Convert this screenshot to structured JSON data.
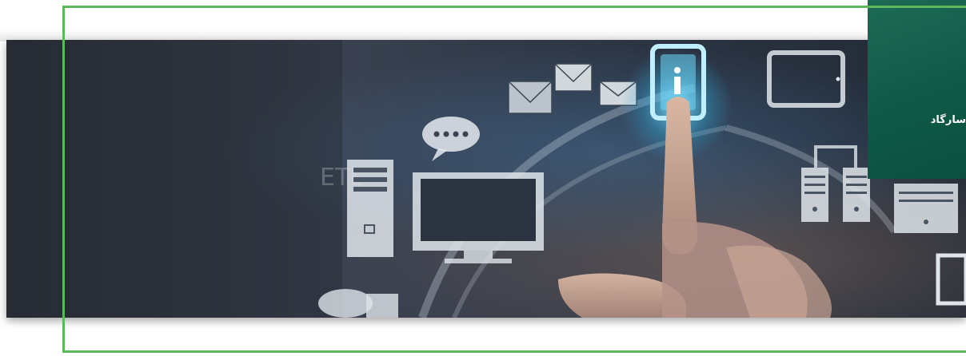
{
  "hero": {
    "watermark_text": "ETL",
    "image_semantic": "hand-touching-technology-icons"
  },
  "info_card": {
    "text": "ﺳﺎرﮔﺎد"
  },
  "colors": {
    "frame_green": "#5cb85c",
    "card_green": "#0f5a47",
    "glow_blue": "#4fc3f7"
  },
  "icons": [
    "mail-icon",
    "chat-bubble-icon",
    "monitor-icon",
    "desktop-tower-icon",
    "tablet-icon",
    "server-icon",
    "touch-glow-icon"
  ]
}
